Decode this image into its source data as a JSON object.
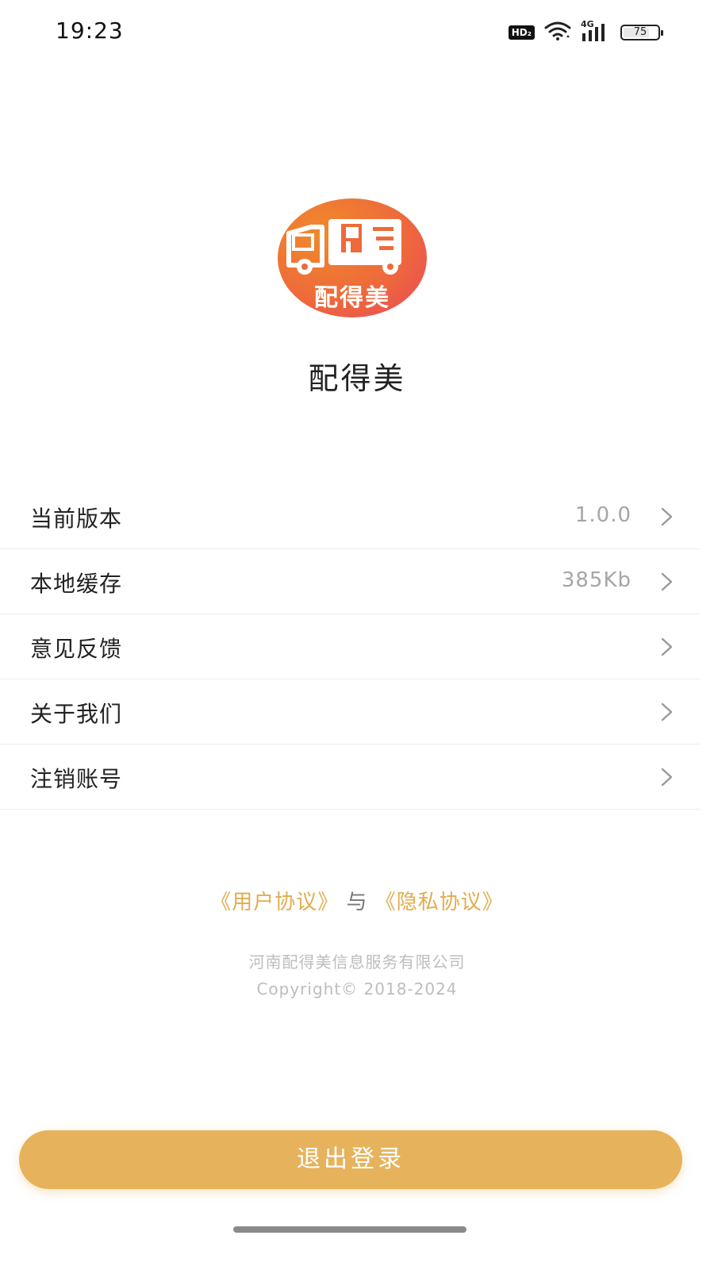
{
  "status_bar": {
    "time": "19:23",
    "hd_label": "HD₂",
    "network_label": "4G",
    "battery_level": "75",
    "icons": [
      "wifi-icon",
      "signal-icon",
      "battery-icon"
    ]
  },
  "app": {
    "logo_text": "配得美",
    "name": "配得美"
  },
  "menu": {
    "items": [
      {
        "label": "当前版本",
        "value": "1.0.0"
      },
      {
        "label": "本地缓存",
        "value": "385Kb"
      },
      {
        "label": "意见反馈",
        "value": ""
      },
      {
        "label": "关于我们",
        "value": ""
      },
      {
        "label": "注销账号",
        "value": ""
      }
    ]
  },
  "agreements": {
    "user_agreement": "《用户协议》",
    "separator": "与",
    "privacy_agreement": "《隐私协议》"
  },
  "footer": {
    "company": "河南配得美信息服务有限公司",
    "copyright": "Copyright© 2018-2024"
  },
  "logout": {
    "label": "退出登录"
  },
  "colors": {
    "accent": "#e6b35c",
    "link": "#e2ac4e",
    "muted": "#bdbdbd"
  }
}
